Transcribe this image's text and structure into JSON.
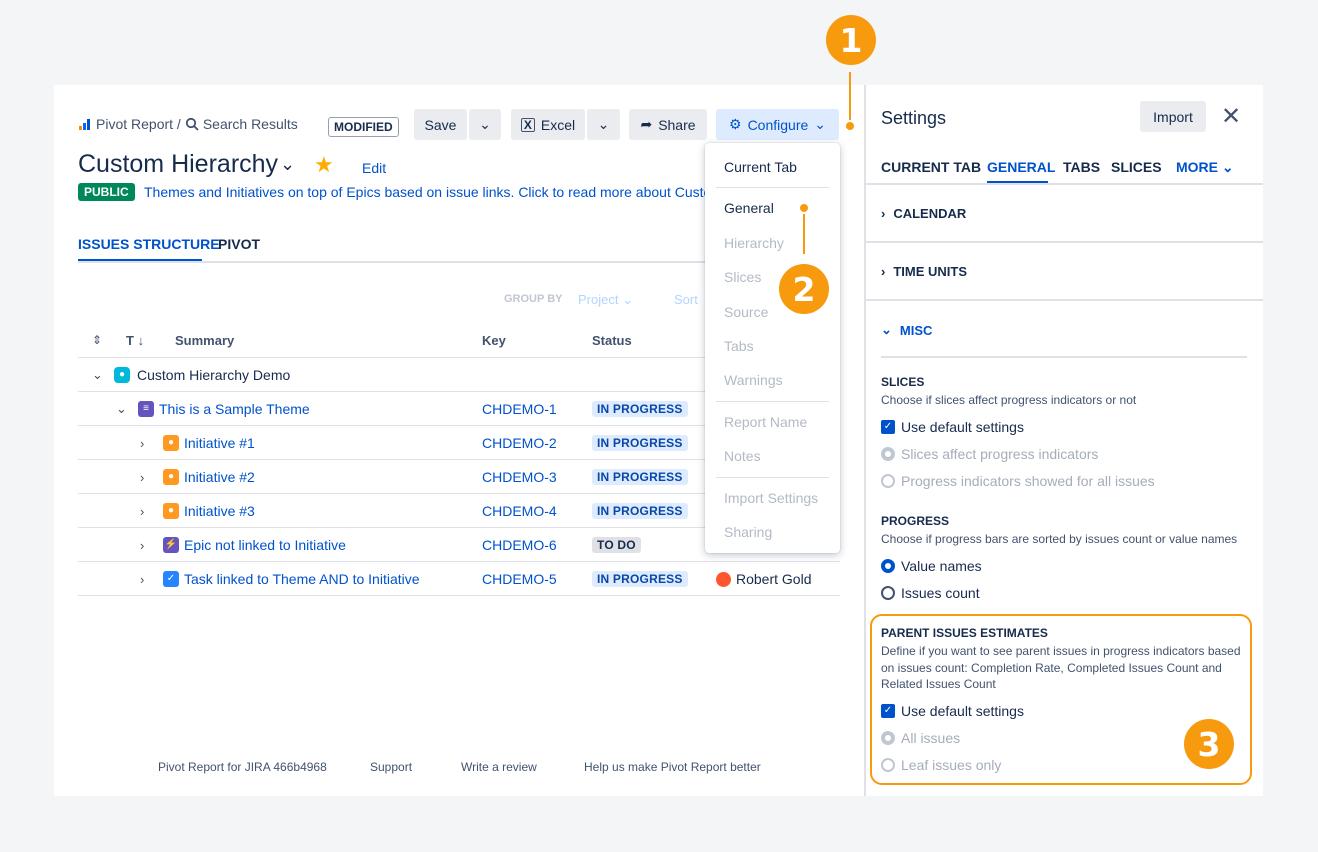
{
  "header": {
    "breadcrumb_app": "Pivot Report /",
    "breadcrumb_page": "Search Results",
    "modified_badge": "MODIFIED",
    "save_label": "Save",
    "excel_label": "Excel",
    "share_label": "Share",
    "configure_label": "Configure",
    "title": "Custom Hierarchy",
    "edit_label": "Edit",
    "public_badge": "PUBLIC",
    "description": "Themes and Initiatives on top of Epics based on issue links. Click to read more about Custo"
  },
  "tabs": {
    "issues_structure": "ISSUES STRUCTURE",
    "pivot": "PIVOT"
  },
  "toolbar": {
    "group_by": "GROUP BY",
    "project": "Project",
    "sort": "Sort"
  },
  "table": {
    "columns": {
      "t": "T",
      "summary": "Summary",
      "key": "Key",
      "status": "Status"
    },
    "rows": [
      {
        "summary": "Custom Hierarchy Demo",
        "key": "",
        "status": ""
      },
      {
        "summary": "This is a Sample Theme",
        "key": "CHDEMO-1",
        "status": "IN PROGRESS"
      },
      {
        "summary": "Initiative #1",
        "key": "CHDEMO-2",
        "status": "IN PROGRESS"
      },
      {
        "summary": "Initiative #2",
        "key": "CHDEMO-3",
        "status": "IN PROGRESS"
      },
      {
        "summary": "Initiative #3",
        "key": "CHDEMO-4",
        "status": "IN PROGRESS"
      },
      {
        "summary": "Epic not linked to Initiative",
        "key": "CHDEMO-6",
        "status": "TO DO"
      },
      {
        "summary": "Task linked to Theme AND to Initiative",
        "key": "CHDEMO-5",
        "status": "IN PROGRESS",
        "assignee": "Robert Gold"
      }
    ]
  },
  "configure_menu": {
    "items": [
      "Current Tab",
      "General",
      "Hierarchy",
      "Slices",
      "Source",
      "Tabs",
      "Warnings",
      "Report Name",
      "Notes",
      "Import Settings",
      "Sharing"
    ]
  },
  "footer": {
    "version": "Pivot Report for JIRA 466b4968",
    "support": "Support",
    "review": "Write a review",
    "help": "Help us make Pivot Report better"
  },
  "settings": {
    "title": "Settings",
    "import_label": "Import",
    "tabs": [
      "CURRENT TAB",
      "GENERAL",
      "TABS",
      "SLICES",
      "MORE"
    ],
    "sections": {
      "calendar": "CALENDAR",
      "time_units": "TIME UNITS",
      "misc": "MISC"
    },
    "slices": {
      "heading": "SLICES",
      "desc": "Choose if slices affect progress indicators or not",
      "opt_default": "Use default settings",
      "opt_affect": "Slices affect progress indicators",
      "opt_all": "Progress indicators showed for all issues"
    },
    "progress": {
      "heading": "PROGRESS",
      "desc": "Choose if progress bars are sorted by issues count or value names",
      "opt_value": "Value names",
      "opt_count": "Issues count"
    },
    "parent": {
      "heading": "PARENT ISSUES ESTIMATES",
      "desc": "Define if you want to see parent issues in progress indicators based on issues count: Completion Rate, Completed Issues Count and Related Issues Count",
      "opt_default": "Use default settings",
      "opt_all": "All issues",
      "opt_leaf": "Leaf issues only"
    }
  },
  "callouts": [
    "1",
    "2",
    "3"
  ],
  "colors": {
    "accent": "#0052cc",
    "callout": "#f79a0e",
    "public": "#00875a"
  }
}
